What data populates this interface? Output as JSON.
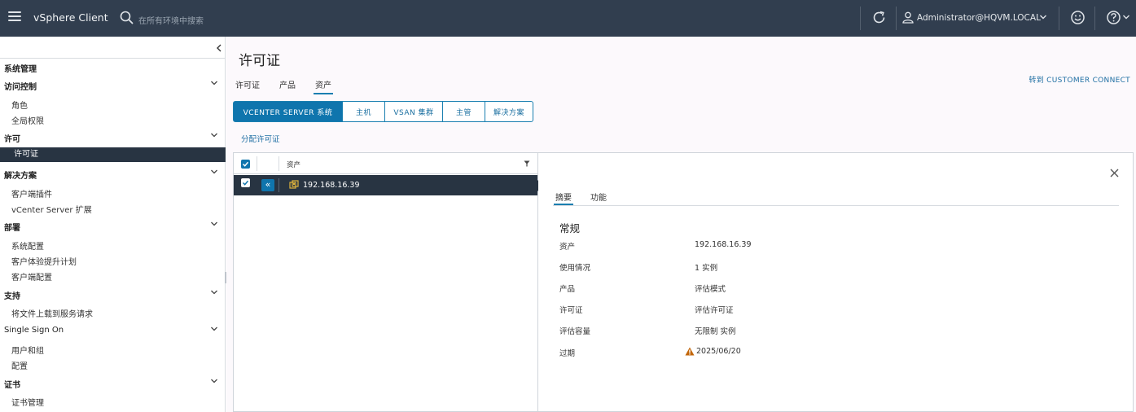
{
  "header": {
    "app_title": "vSphere Client",
    "search_placeholder": "在所有环境中搜索",
    "user": "Administrator@HQVM.LOCAL"
  },
  "sidebar": {
    "section_title": "系统管理",
    "groups": [
      {
        "label": "访问控制",
        "items": [
          "角色",
          "全局权限"
        ]
      },
      {
        "label": "许可",
        "items": [
          "许可证"
        ]
      },
      {
        "label": "解决方案",
        "items": [
          "客户端插件",
          "vCenter Server 扩展"
        ]
      },
      {
        "label": "部署",
        "items": [
          "系统配置",
          "客户体验提升计划",
          "客户端配置"
        ]
      },
      {
        "label": "支持",
        "items": [
          "将文件上载到服务请求"
        ]
      },
      {
        "label": "Single Sign On",
        "items": [
          "用户和组",
          "配置"
        ]
      },
      {
        "label": "证书",
        "items": [
          "证书管理"
        ]
      }
    ],
    "active_item": "许可证"
  },
  "main": {
    "title": "许可证",
    "tabs": [
      "许可证",
      "产品",
      "资产"
    ],
    "active_tab": "资产",
    "customer_connect": "转到 CUSTOMER CONNECT",
    "segments": [
      "VCENTER SERVER 系统",
      "主机",
      "VSAN 集群",
      "主管",
      "解决方案"
    ],
    "active_segment": "VCENTER SERVER 系统",
    "assign_link": "分配许可证"
  },
  "grid": {
    "column": "资产",
    "rows": [
      {
        "label": "192.168.16.39",
        "selected": true
      }
    ]
  },
  "detail": {
    "tabs": [
      "摘要",
      "功能"
    ],
    "active_tab": "摘要",
    "section": "常规",
    "fields": [
      {
        "key": "资产",
        "value": "192.168.16.39"
      },
      {
        "key": "使用情况",
        "value": "1 实例"
      },
      {
        "key": "产品",
        "value": "评估模式"
      },
      {
        "key": "许可证",
        "value": "评估许可证"
      },
      {
        "key": "评估容量",
        "value": "无限制 实例"
      },
      {
        "key": "过期",
        "value": "2025/06/20",
        "warning": true
      }
    ]
  },
  "colors": {
    "header_bg": "#313e4f",
    "accent": "#0f75ad",
    "selected_row": "#283442",
    "warning": "#c2660a"
  }
}
